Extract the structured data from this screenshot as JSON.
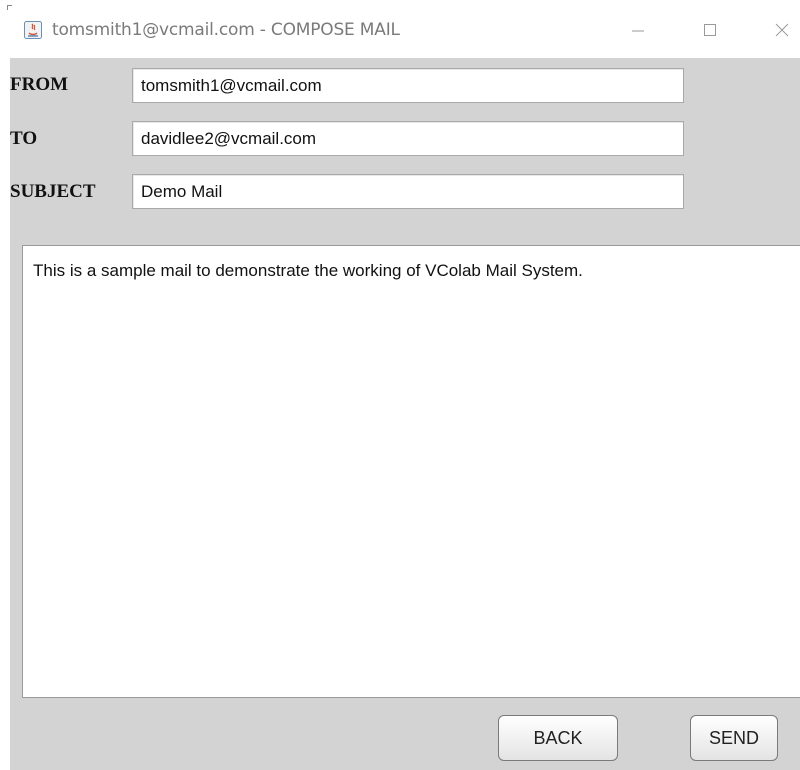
{
  "window": {
    "title": "tomsmith1@vcmail.com - COMPOSE MAIL",
    "app_icon": "java-icon",
    "controls": [
      "minimize-icon",
      "maximize-icon",
      "close-icon"
    ]
  },
  "form": {
    "from_label": "FROM",
    "from_value": "tomsmith1@vcmail.com",
    "to_label": "TO",
    "to_value": "davidlee2@vcmail.com",
    "subject_label": "SUBJECT",
    "subject_value": "Demo Mail",
    "body_text": "This is a sample mail to demonstrate the working of VColab Mail System."
  },
  "actions": {
    "back_label": "BACK",
    "send_label": "SEND"
  },
  "colors": {
    "panel_background": "#d3d3d3",
    "titlebar_background": "#ffffff",
    "title_text": "#7a7a7a"
  }
}
